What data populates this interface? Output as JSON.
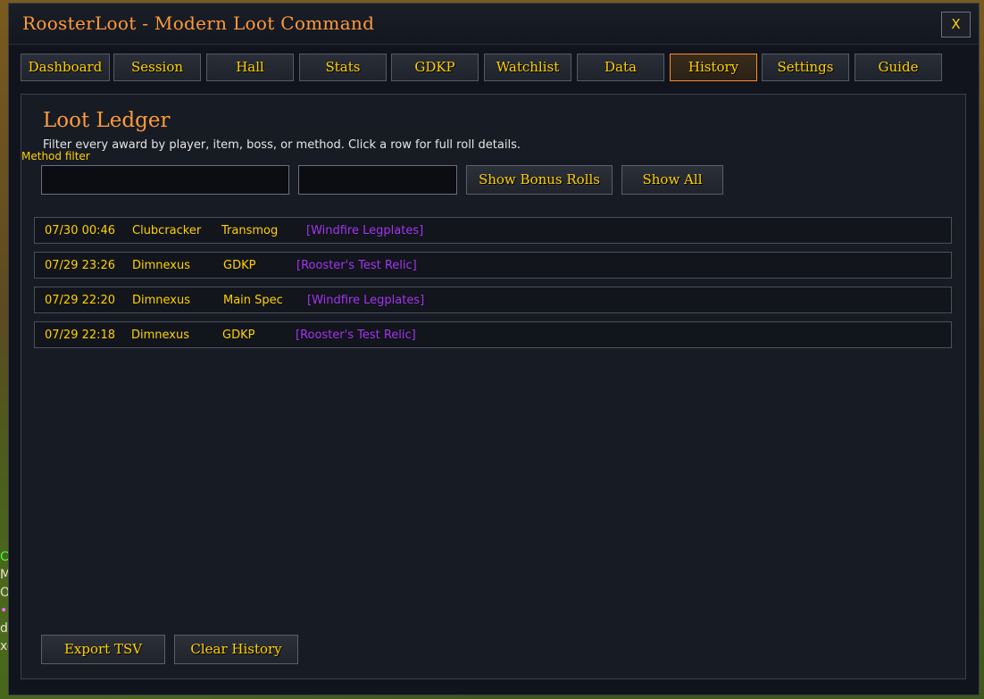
{
  "window": {
    "title": "RoosterLoot - Modern Loot Command",
    "close_label": "X"
  },
  "background_scrap": [
    "C",
    "M",
    "Or",
    "•",
    "de",
    "xe"
  ],
  "tabs": [
    {
      "label": "Dashboard",
      "active": false
    },
    {
      "label": "Session",
      "active": false
    },
    {
      "label": "Hall",
      "active": false
    },
    {
      "label": "Stats",
      "active": false
    },
    {
      "label": "GDKP",
      "active": false
    },
    {
      "label": "Watchlist",
      "active": false
    },
    {
      "label": "Data",
      "active": false
    },
    {
      "label": "History",
      "active": true
    },
    {
      "label": "Settings",
      "active": false
    },
    {
      "label": "Guide",
      "active": false
    }
  ],
  "history": {
    "title": "Loot Ledger",
    "subtitle": "Filter every award by player, item, boss, or method. Click a row for full roll details.",
    "method_filter_label": "Method filter",
    "search_value": "",
    "method_value": "",
    "show_bonus_rolls_label": "Show Bonus Rolls",
    "show_all_label": "Show All",
    "rows": [
      {
        "time": "07/30 00:46",
        "player": "Clubcracker",
        "method": "Transmog",
        "item": "[Windfire Legplates]"
      },
      {
        "time": "07/29 23:26",
        "player": "Dimnexus",
        "method": "GDKP",
        "item": "[Rooster's Test Relic]"
      },
      {
        "time": "07/29 22:20",
        "player": "Dimnexus",
        "method": "Main Spec",
        "item": "[Windfire Legplates]"
      },
      {
        "time": "07/29 22:18",
        "player": "Dimnexus",
        "method": "GDKP",
        "item": "[Rooster's Test Relic]"
      }
    ],
    "export_label": "Export TSV",
    "clear_label": "Clear History"
  },
  "colors": {
    "accent_orange": "#ff9a3c",
    "gold_text": "#ffd100",
    "epic_item": "#a335ee",
    "active_tab_border": "#ff8c2a"
  }
}
